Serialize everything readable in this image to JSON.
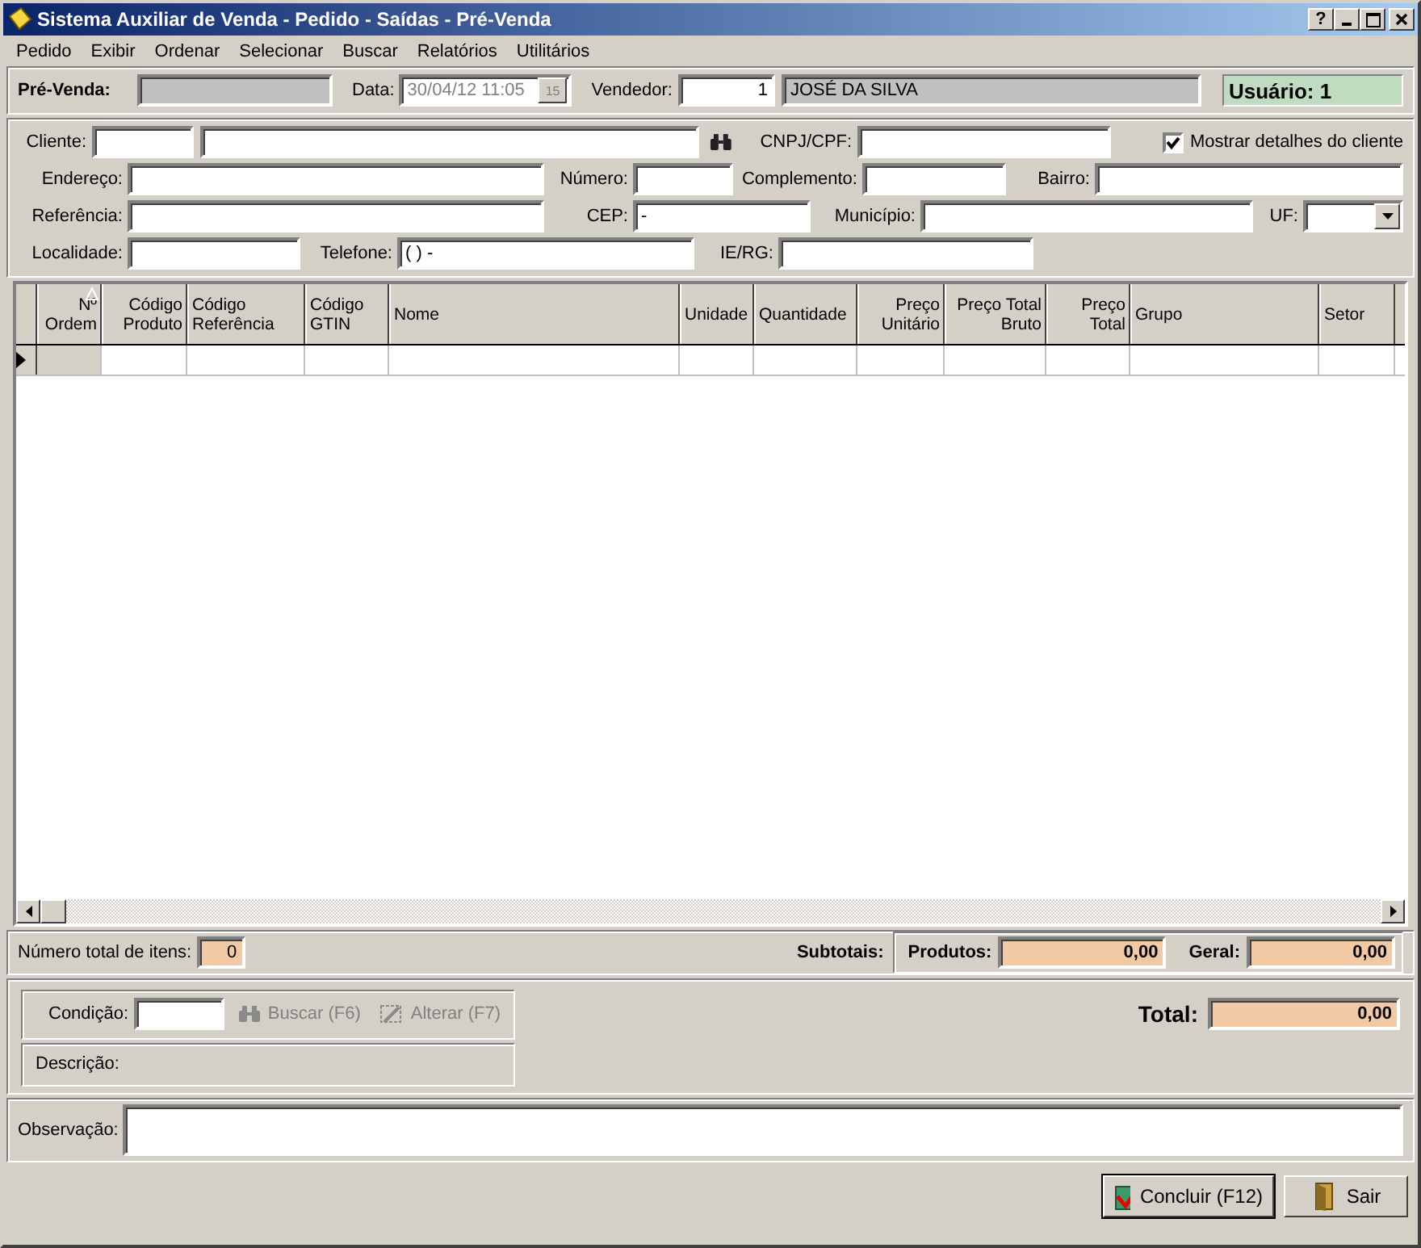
{
  "window": {
    "title": "Sistema Auxiliar de Venda - Pedido - Saídas - Pré-Venda",
    "help": "?"
  },
  "menu": [
    "Pedido",
    "Exibir",
    "Ordenar",
    "Selecionar",
    "Buscar",
    "Relatórios",
    "Utilitários"
  ],
  "header": {
    "prevenda_label": "Pré-Venda:",
    "data_label": "Data:",
    "data_value": "30/04/12 11:05",
    "data_disabled": true,
    "calendar": "15",
    "vendedor_label": "Vendedor:",
    "vendedor_code": "1",
    "vendedor_name": "JOSÉ DA SILVA",
    "usuario": "Usuário: 1"
  },
  "client": {
    "cliente_label": "Cliente:",
    "cnpj_label": "CNPJ/CPF:",
    "show_details": {
      "label": "Mostrar detalhes do cliente",
      "checked": true
    },
    "rows": [
      [
        {
          "label": "Endereço:"
        },
        {
          "label": "Número:"
        },
        {
          "label": "Complemento:"
        },
        {
          "label": "Bairro:"
        }
      ],
      [
        {
          "label": "Referência:"
        },
        {
          "label": "CEP:",
          "value": "-"
        },
        {
          "label": "Município:"
        },
        {
          "label": "UF:",
          "kind": "combo"
        }
      ],
      [
        {
          "label": "Localidade:"
        },
        {
          "label": "Telefone:",
          "value": "(  )      -"
        },
        {
          "label": "IE/RG:"
        }
      ]
    ]
  },
  "table": {
    "columns": [
      {
        "label": "Nº Ordem",
        "sorted": true
      },
      {
        "label": "Código Produto"
      },
      {
        "label": "Código Referência"
      },
      {
        "label": "Código GTIN"
      },
      {
        "label": "Nome"
      },
      {
        "label": "Unidade"
      },
      {
        "label": "Quantidade"
      },
      {
        "label": "Preço Unitário"
      },
      {
        "label": "Preço Total Bruto"
      },
      {
        "label": "Preço Total"
      },
      {
        "label": "Grupo"
      },
      {
        "label": "Setor"
      }
    ],
    "rows": [
      {
        "selected": true
      }
    ]
  },
  "totals": {
    "items_label": "Número total de itens:",
    "items_value": "0",
    "subtotais_label": "Subtotais:",
    "produtos_label": "Produtos:",
    "produtos_value": "0,00",
    "geral_label": "Geral:",
    "geral_value": "0,00",
    "total_label": "Total:",
    "total_value": "0,00"
  },
  "condition": {
    "label": "Condição:",
    "buttons": [
      {
        "label": "Buscar (F6)",
        "kind": "search",
        "disabled": true
      },
      {
        "label": "Alterar (F7)",
        "kind": "edit",
        "disabled": true
      }
    ],
    "descricao_label": "Descrição:"
  },
  "observacao_label": "Observação:",
  "buttons": [
    {
      "label": "Concluir (F12)",
      "kind": "confirm",
      "default": true
    },
    {
      "label": "Sair",
      "kind": "exit",
      "default": false
    }
  ]
}
